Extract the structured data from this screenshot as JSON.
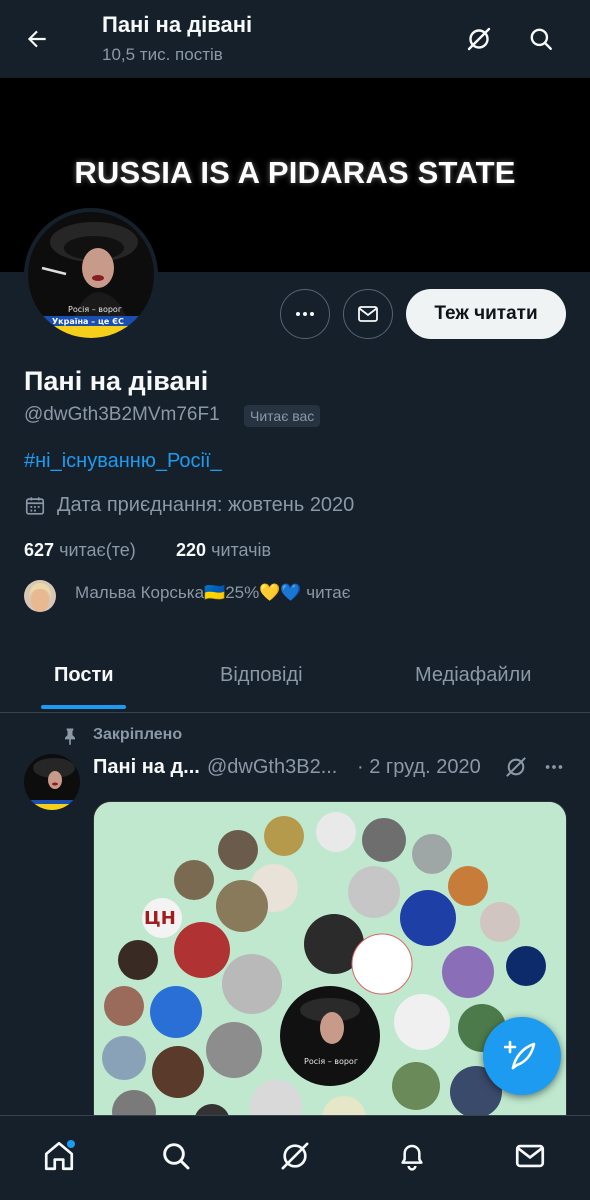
{
  "header": {
    "title": "Пані на дівані",
    "subtitle": "10,5 тис. постів"
  },
  "banner": {
    "text": "RUSSIA IS A PIDARAS STATE"
  },
  "avatar": {
    "caption_line1": "Росія – ворог",
    "caption_line2": "Україна – це ЄС"
  },
  "profile": {
    "follow_button": "Теж читати",
    "name": "Пані на дівані",
    "handle": "@dwGth3B2MVm76F1",
    "follows_you": "Читає вас",
    "bio_hashtag": "#ні_існуванню_Росії_",
    "joined": "Дата приєднання: жовтень 2020",
    "following_count": "627",
    "following_label": "читає(те)",
    "followers_count": "220",
    "followers_label": "читачів",
    "followed_by": "Мальва Корська🇺🇦25%💛💙 читає"
  },
  "tabs": [
    {
      "label": "Пости",
      "active": true
    },
    {
      "label": "Відповіді",
      "active": false
    },
    {
      "label": "Медіафайли",
      "active": false
    }
  ],
  "pinned_tweet": {
    "pinned_label": "Закріплено",
    "author_name": "Пані на д...",
    "author_handle": "@dwGth3B2...",
    "date": "· 2 груд. 2020",
    "media_center_caption": "Росія – ворог",
    "media_small_label": "ЦН"
  },
  "colors": {
    "background": "#15202b",
    "accent": "#1d9bf0",
    "muted_text": "#8b98a5",
    "media_background": "#bfe8cf"
  },
  "icons": {
    "back": "arrow-left-icon",
    "grok": "grok-icon",
    "search": "search-icon",
    "more": "more-icon",
    "message": "message-icon",
    "calendar": "calendar-icon",
    "pin": "pin-icon",
    "compose": "compose-icon",
    "nav_home": "home-icon",
    "nav_search": "search-icon",
    "nav_grok": "grok-icon",
    "nav_notifications": "bell-icon",
    "nav_messages": "mail-icon"
  }
}
